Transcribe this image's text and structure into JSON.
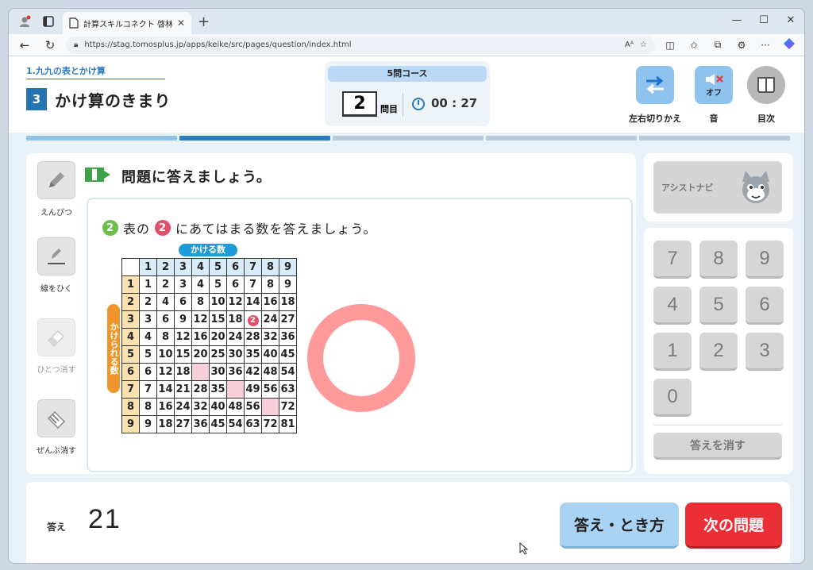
{
  "browser": {
    "tab_title": "計算スキルコネクト 啓林館版",
    "url": "https://stag.tomosplus.jp/apps/keike/src/pages/question/index.html",
    "reader_label": "Aᴬ"
  },
  "header": {
    "unit_title": "1.九九の表とかけ算",
    "lesson_number": "3",
    "lesson_title": "かけ算のきまり",
    "course_label": "5問コース",
    "question_number": "2",
    "question_suffix": "問目",
    "timer": "00 : 27",
    "switch_label": "左右切りかえ",
    "sound_state": "オフ",
    "sound_label": "音",
    "contents_label": "目次",
    "progress_total": 5,
    "progress_current": 2
  },
  "tools": {
    "pencil": "えんぴつ",
    "line": "線をひく",
    "erase_one": "ひとつ消す",
    "erase_all": "ぜんぶ消す"
  },
  "question": {
    "prompt": "問題に答えましょう。",
    "sub_number": "2",
    "sub_text_a": "表の",
    "sub_marker": "2",
    "sub_text_b": "にあてはまる数を答えましょう。",
    "col_header_label": "かける数",
    "row_header_label": "かけられる数"
  },
  "table": {
    "col_headers": [
      "1",
      "2",
      "3",
      "4",
      "5",
      "6",
      "7",
      "8",
      "9"
    ],
    "rows": [
      {
        "h": "1",
        "cells": [
          "1",
          "2",
          "3",
          "4",
          "5",
          "6",
          "7",
          "8",
          "9"
        ]
      },
      {
        "h": "2",
        "cells": [
          "2",
          "4",
          "6",
          "8",
          "10",
          "12",
          "14",
          "16",
          "18"
        ]
      },
      {
        "h": "3",
        "cells": [
          "3",
          "6",
          "9",
          "12",
          "15",
          "18",
          "●2",
          "24",
          "27"
        ]
      },
      {
        "h": "4",
        "cells": [
          "4",
          "8",
          "12",
          "16",
          "20",
          "24",
          "28",
          "32",
          "36"
        ]
      },
      {
        "h": "5",
        "cells": [
          "5",
          "10",
          "15",
          "20",
          "25",
          "30",
          "35",
          "40",
          "45"
        ]
      },
      {
        "h": "6",
        "cells": [
          "6",
          "12",
          "18",
          "",
          "30",
          "36",
          "42",
          "48",
          "54"
        ]
      },
      {
        "h": "7",
        "cells": [
          "7",
          "14",
          "21",
          "28",
          "35",
          "",
          "49",
          "56",
          "63"
        ]
      },
      {
        "h": "8",
        "cells": [
          "8",
          "16",
          "24",
          "32",
          "40",
          "48",
          "56",
          "",
          "72"
        ]
      },
      {
        "h": "9",
        "cells": [
          "9",
          "18",
          "27",
          "36",
          "45",
          "54",
          "63",
          "72",
          "81"
        ]
      }
    ]
  },
  "assist": {
    "label": "アシストナビ"
  },
  "keypad": {
    "keys": [
      "7",
      "8",
      "9",
      "4",
      "5",
      "6",
      "1",
      "2",
      "3",
      "0"
    ],
    "clear_label": "答えを消す"
  },
  "answer": {
    "label": "答え",
    "value": "21",
    "hint_button": "答え・とき方",
    "next_button": "次の問題"
  },
  "colors": {
    "accent_blue": "#2473b3",
    "ring_pink": "#ff9a9a",
    "next_red": "#ec2f36"
  }
}
